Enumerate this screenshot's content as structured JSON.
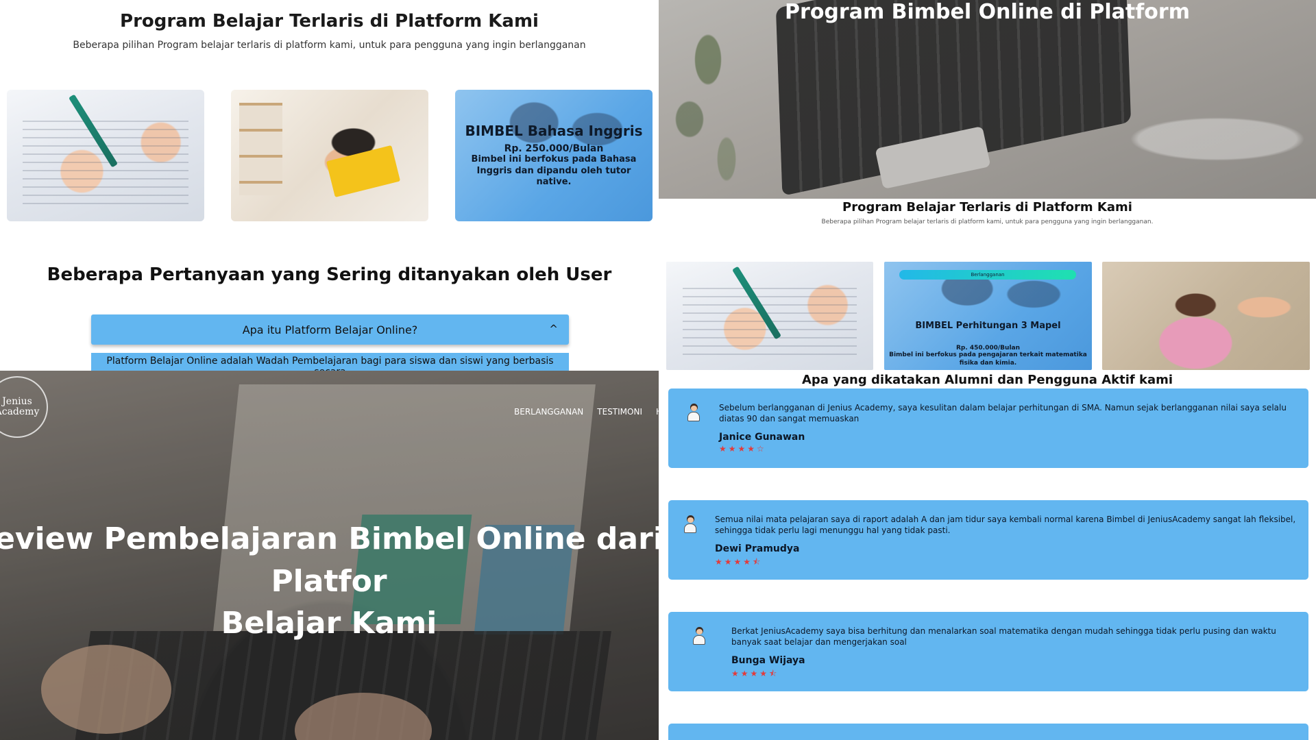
{
  "top_left": {
    "title": "Program Belajar Terlaris di Platform Kami",
    "subtitle": "Beberapa pilihan Program belajar terlaris di platform kami, untuk para pengguna yang ingin berlangganan",
    "card3": {
      "title": "BIMBEL Bahasa Inggris",
      "price": "Rp. 250.000/Bulan",
      "description": "Bimbel ini berfokus pada Bahasa Inggris dan dipandu oleh tutor native."
    },
    "faq_title": "Beberapa Pertanyaan yang Sering ditanyakan oleh User",
    "faq_question": "Apa itu Platform Belajar Online?",
    "faq_chevron": "^",
    "faq_answer": "Platform Belajar Online adalah Wadah Pembelajaran bagi para siswa dan siswi yang berbasis secara"
  },
  "bottom_left": {
    "logo_text": "Jenius\nAcademy",
    "nav": [
      "BERLANGGANAN",
      "TESTIMONI",
      "H"
    ],
    "hero_line1": "eview Pembelajaran Bimbel Online dari Platfor",
    "hero_line2": "Belajar Kami"
  },
  "right": {
    "hero_title": "Program Bimbel Online di Platform",
    "title": "Program Belajar Terlaris di Platform Kami",
    "subtitle": "Beberapa pilihan Program belajar terlaris di platform kami, untuk para pengguna yang ingin berlangganan.",
    "card2": {
      "pill": "Berlangganan",
      "title": "BIMBEL Perhitungan 3 Mapel",
      "price": "Rp. 450.000/Bulan",
      "description": "Bimbel ini berfokus pada pengajaran terkait matematika fisika dan kimia."
    },
    "alumni_title": "Apa yang dikatakan Alumni dan Pengguna Aktif kami",
    "testimonials": [
      {
        "text": "Sebelum berlangganan di Jenius Academy, saya kesulitan dalam belajar perhitungan di SMA. Namun sejak berlangganan nilai saya selalu diatas 90 dan sangat memuaskan",
        "name": "Janice Gunawan",
        "stars": "★★★★☆",
        "rating": 4
      },
      {
        "text": "Semua nilai mata pelajaran saya di raport adalah A dan jam tidur saya kembali normal karena Bimbel di JeniusAcademy sangat lah fleksibel, sehingga tidak perlu lagi menunggu hal yang tidak pasti.",
        "name": "Dewi Pramudya",
        "stars": "★★★★⯪",
        "rating": 4.5
      },
      {
        "text": "Berkat JeniusAcademy saya bisa berhitung dan menalarkan soal matematika dengan mudah sehingga tidak perlu pusing dan waktu banyak saat belajar dan mengerjakan soal",
        "name": "Bunga Wijaya",
        "stars": "★★★★⯪",
        "rating": 4.5
      }
    ]
  },
  "colors": {
    "accent_blue": "#62b6f0",
    "star_red": "#e23b3b",
    "text_dark": "#111111"
  }
}
